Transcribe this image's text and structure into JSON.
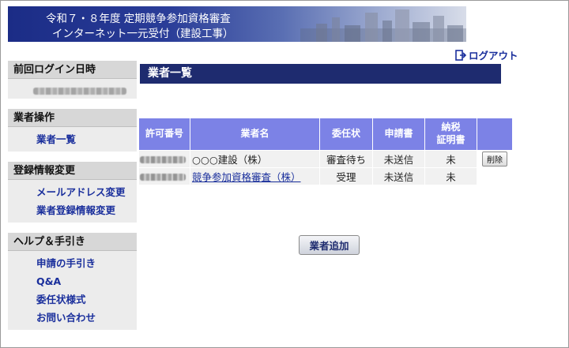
{
  "header": {
    "line1": "令和７・８年度 定期競争参加資格審査",
    "line2": "インターネット一元受付（建設工事）"
  },
  "logout_label": "ログアウト",
  "sidebar": {
    "last_login": {
      "title": "前回ログイン日時"
    },
    "sections": [
      {
        "title": "業者操作",
        "items": [
          "業者一覧"
        ]
      },
      {
        "title": "登録情報変更",
        "items": [
          "メールアドレス変更",
          "業者登録情報変更"
        ]
      },
      {
        "title": "ヘルプ＆手引き",
        "items": [
          "申請の手引き",
          "Q&A",
          "委任状様式",
          "お問い合わせ"
        ]
      }
    ]
  },
  "main": {
    "title": "業者一覧",
    "columns": [
      "許可番号",
      "業者名",
      "委任状",
      "申請書",
      "納税\n証明書",
      ""
    ],
    "rows": [
      {
        "name": "○○○建設（株）",
        "proxy": "審査待ち",
        "application": "未送信",
        "tax": "未",
        "action": "削除"
      },
      {
        "name": "競争参加資格審査（株）",
        "proxy": "受理",
        "application": "未送信",
        "tax": "未",
        "action": ""
      }
    ],
    "add_button": "業者追加"
  },
  "colors": {
    "banner": "#1b2c86",
    "title_bar": "#1e2b6f",
    "table_header": "#7c82e6",
    "link": "#1a2f9c"
  }
}
